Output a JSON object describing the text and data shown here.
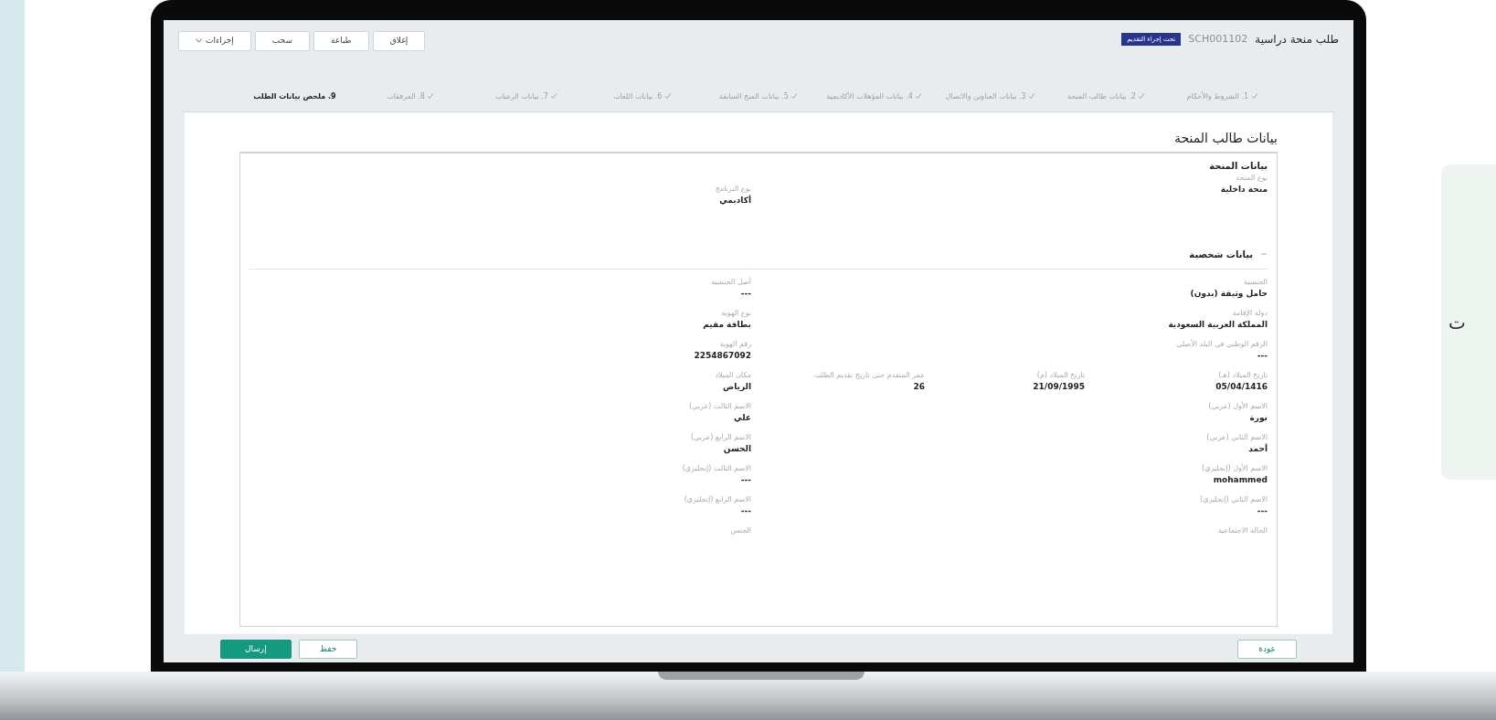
{
  "side_card": {
    "text": "ت"
  },
  "header": {
    "title": "طلب منحة دراسية",
    "request_id": "SCH001102",
    "status_badge": "تحت إجراء التقديم",
    "actions": [
      {
        "label": "إغلاق",
        "kind": "button"
      },
      {
        "label": "طباعة",
        "kind": "button"
      },
      {
        "label": "سحب",
        "kind": "button"
      },
      {
        "label": "إجراءات",
        "kind": "dropdown"
      }
    ]
  },
  "steps": [
    {
      "label": "1. الشروط والأحكام",
      "completed": true,
      "selected": false
    },
    {
      "label": "2. بيانات طالب المنحة",
      "completed": true,
      "selected": false
    },
    {
      "label": "3. بيانات العناوين والاتصال",
      "completed": true,
      "selected": false
    },
    {
      "label": "4. بيانات المؤهلات الأكاديمية",
      "completed": true,
      "selected": false
    },
    {
      "label": "5. بيانات المنح السابقة",
      "completed": true,
      "selected": false
    },
    {
      "label": "6. بيانات اللغات",
      "completed": true,
      "selected": false
    },
    {
      "label": "7. بيانات الرغبات",
      "completed": true,
      "selected": false
    },
    {
      "label": "8. المرفقات",
      "completed": true,
      "selected": false
    },
    {
      "label": "9. ملخص بيانات الطلب",
      "completed": false,
      "selected": true
    }
  ],
  "section_title": "بيانات طالب المنحة",
  "scholarship": {
    "title": "بيانات المنحة",
    "fields": [
      {
        "label": "نوع المنحة",
        "value": "منحة داخلية"
      },
      {
        "label": "نوع البرنامج",
        "value": "أكاديمي"
      }
    ]
  },
  "personal": {
    "title": "بيانات شخصية",
    "expanded": true,
    "rows": [
      [
        {
          "label": "الجنسية",
          "value": "حامل وثيقة (بدون)"
        },
        null,
        null,
        {
          "label": "أصل الجنسية",
          "value": "---"
        }
      ],
      [
        {
          "label": "دولة الإقامة",
          "value": "المملكة العربية السعودية"
        },
        null,
        null,
        {
          "label": "نوع الهوية",
          "value": "بطاقة مقيم"
        }
      ],
      [
        {
          "label": "الرقم الوطني في البلد الأصلي",
          "value": "---"
        },
        null,
        null,
        {
          "label": "رقم الهوية",
          "value": "2254867092"
        }
      ],
      [
        {
          "label": "تاريخ الميلاد (هـ)",
          "value": "05/04/1416"
        },
        {
          "label": "تاريخ الميلاد (م)",
          "value": "21/09/1995"
        },
        {
          "label": "عمر المتقدم حتى تاريخ تقديم الطلب",
          "value": "26"
        },
        {
          "label": "مكان الميلاد",
          "value": "الرياض"
        }
      ],
      [
        {
          "label": "الاسم الأول (عربي)",
          "value": "نورة"
        },
        null,
        null,
        {
          "label": "الاسم الثالث (عربي)",
          "value": "علي"
        }
      ],
      [
        {
          "label": "الاسم الثاني (عربي)",
          "value": "أحمد"
        },
        null,
        null,
        {
          "label": "الاسم الرابع (عربي)",
          "value": "الحسن"
        }
      ],
      [
        {
          "label": "الاسم الأول (إنجليزي)",
          "value": "mohammed"
        },
        null,
        null,
        {
          "label": "الاسم الثالث (إنجليزي)",
          "value": "---"
        }
      ],
      [
        {
          "label": "الاسم الثاني (إنجليزي)",
          "value": "---"
        },
        null,
        null,
        {
          "label": "الاسم الرابع (إنجليزي)",
          "value": "---"
        }
      ],
      [
        {
          "label": "الحالة الاجتماعية"
        },
        null,
        null,
        {
          "label": "الجنس"
        }
      ]
    ]
  },
  "footer": {
    "back": "عودة",
    "save": "حفظ",
    "submit": "إرسال"
  }
}
